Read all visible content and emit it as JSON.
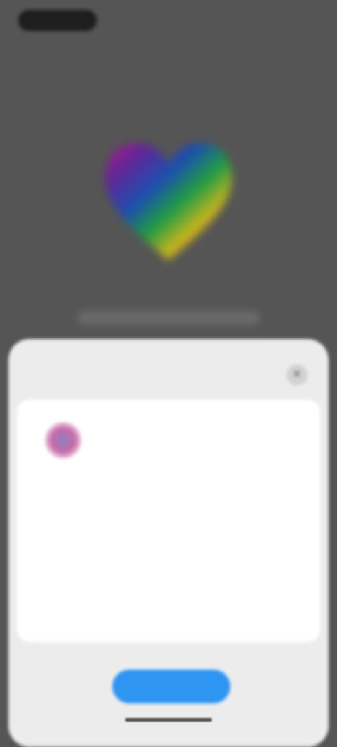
{
  "colors": {
    "background": "#555555",
    "sheet": "#ececec",
    "card": "#ffffff",
    "accent_button": "#2f95f2"
  },
  "icons": {
    "hero": "rainbow-heart-icon",
    "close": "close-icon",
    "app": "app-logo-icon"
  },
  "hero": {
    "heading": ""
  },
  "sheet": {
    "title": "",
    "close_glyph": "✕",
    "app": {
      "name": "",
      "subtitle": ""
    },
    "detail_1": "",
    "detail_2": "",
    "description": "",
    "primary_button_label": ""
  }
}
